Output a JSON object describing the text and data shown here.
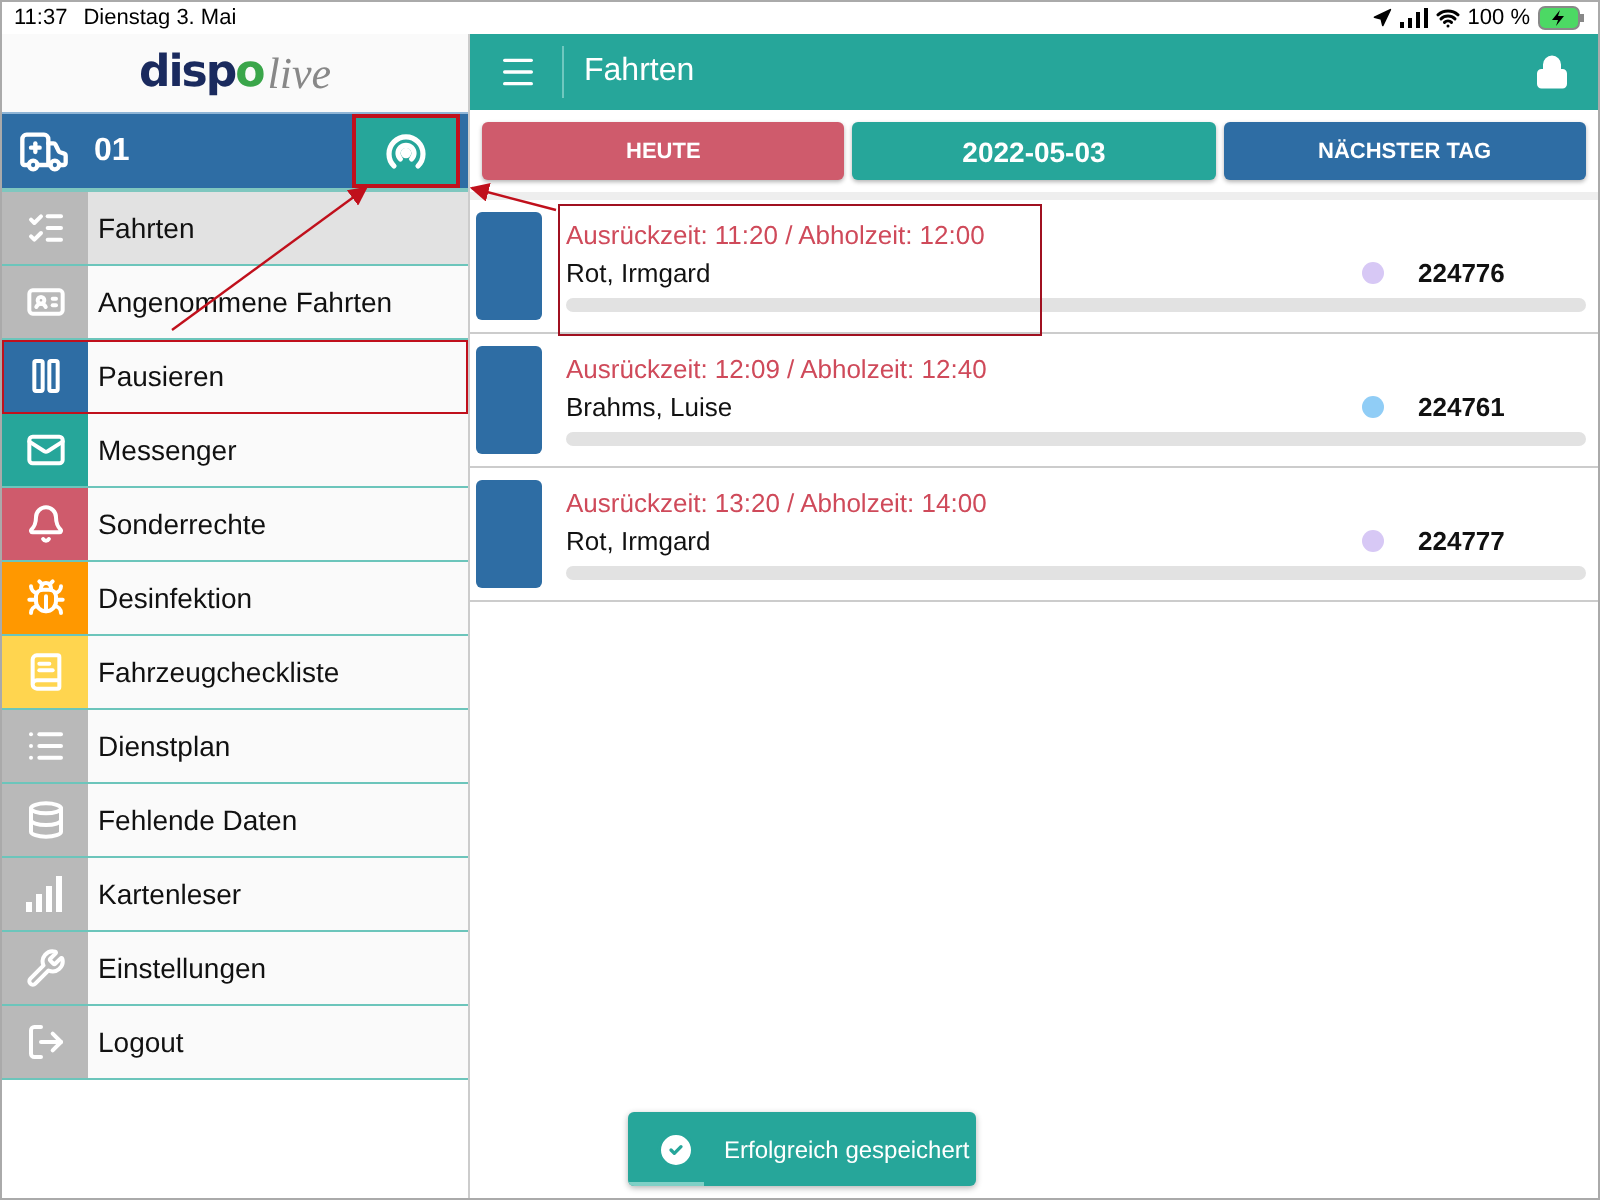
{
  "status_bar": {
    "time": "11:37",
    "date": "Dienstag 3. Mai",
    "battery": "100 %"
  },
  "logo": {
    "primary": "disp",
    "accent": "o",
    "secondary": "live"
  },
  "vehicle": {
    "number": "01",
    "broadcast_highlighted": true
  },
  "menu": [
    {
      "label": "Fahrten",
      "color": "#b9b9b9",
      "selected": true,
      "highlighted": false
    },
    {
      "label": "Angenommene Fahrten",
      "color": "#b9b9b9",
      "selected": false,
      "highlighted": false
    },
    {
      "label": "Pausieren",
      "color": "#2e6da4",
      "selected": false,
      "highlighted": true
    },
    {
      "label": "Messenger",
      "color": "#26a69a",
      "selected": false,
      "highlighted": false
    },
    {
      "label": "Sonderrechte",
      "color": "#cf5b6c",
      "selected": false,
      "highlighted": false
    },
    {
      "label": "Desinfektion",
      "color": "#ff9800",
      "selected": false,
      "highlighted": false
    },
    {
      "label": "Fahrzeugcheckliste",
      "color": "#ffd54f",
      "selected": false,
      "highlighted": false
    },
    {
      "label": "Dienstplan",
      "color": "#b9b9b9",
      "selected": false,
      "highlighted": false
    },
    {
      "label": "Fehlende Daten",
      "color": "#b9b9b9",
      "selected": false,
      "highlighted": false
    },
    {
      "label": "Kartenleser",
      "color": "#b9b9b9",
      "selected": false,
      "highlighted": false
    },
    {
      "label": "Einstellungen",
      "color": "#b9b9b9",
      "selected": false,
      "highlighted": false
    },
    {
      "label": "Logout",
      "color": "#b9b9b9",
      "selected": false,
      "highlighted": false
    }
  ],
  "header": {
    "title": "Fahrten"
  },
  "day_buttons": [
    {
      "label": "HEUTE",
      "color": "#cf5b6c"
    },
    {
      "label": "2022-05-03",
      "color": "#26a69a"
    },
    {
      "label": "NÄCHSTER TAG",
      "color": "#2e6da4"
    }
  ],
  "trips": [
    {
      "times": "Ausrückzeit: 11:20 / Abholzeit: 12:00",
      "name": "Rot, Irmgard",
      "color": "#d7c8f5",
      "number": "224776",
      "highlighted": true
    },
    {
      "times": "Ausrückzeit: 12:09 / Abholzeit: 12:40",
      "name": "Brahms, Luise",
      "color": "#90cdf6",
      "number": "224761",
      "highlighted": false
    },
    {
      "times": "Ausrückzeit: 13:20 / Abholzeit: 14:00",
      "name": "Rot, Irmgard",
      "color": "#d7c8f5",
      "number": "224777",
      "highlighted": false
    }
  ],
  "toast": {
    "message": "Erfolgreich gespeichert",
    "level": 0.22
  }
}
